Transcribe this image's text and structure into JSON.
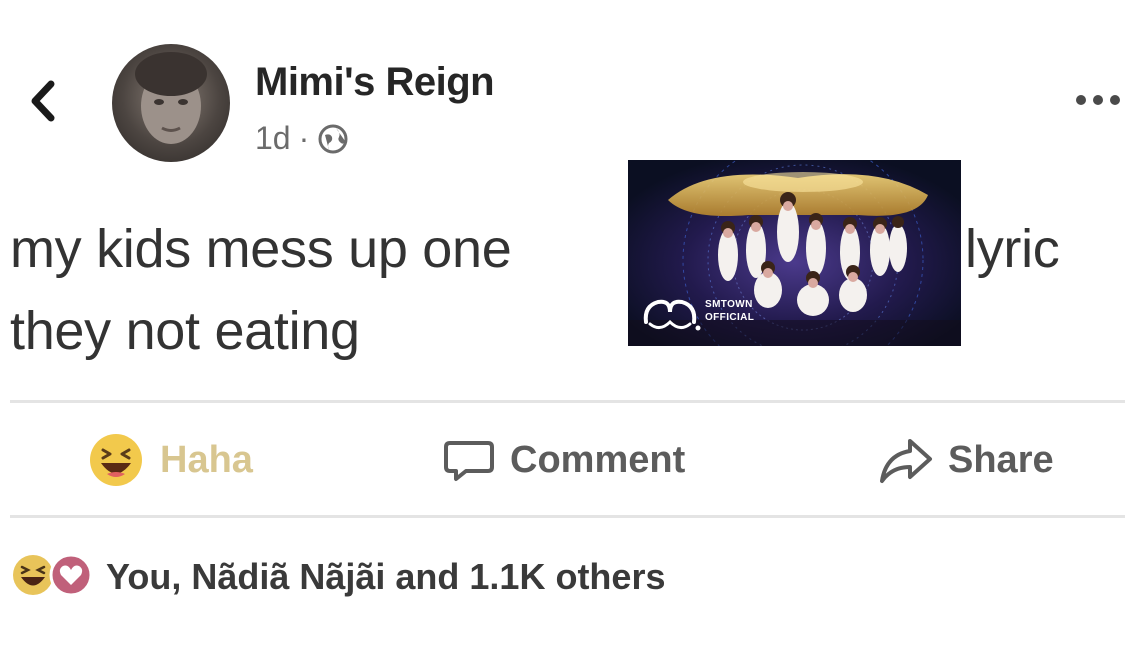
{
  "post": {
    "author": "Mimi's Reign",
    "time": "1d",
    "separator": "·",
    "text_before": "my kids mess up one",
    "text_after": "lyric",
    "text_line2": "they not eating",
    "embed": {
      "channel_line1": "SMTOWN",
      "channel_line2": "OFFICIAL"
    }
  },
  "actions": {
    "haha": "Haha",
    "comment": "Comment",
    "share": "Share"
  },
  "reactions": {
    "summary": "You, Nãdiã Nãjãi and 1.1K others"
  },
  "icons": {
    "back": "chevron-left-icon",
    "more": "more-horizontal-icon",
    "privacy": "globe-icon",
    "haha": "haha-emoji-icon",
    "comment": "comment-bubble-icon",
    "share": "share-arrow-icon",
    "love": "heart-icon"
  },
  "colors": {
    "haha_label": "#d8c690",
    "haha_emoji": "#f2c94c",
    "love_badge": "#c0607a",
    "text": "#333333",
    "muted": "#6b6b6b"
  }
}
